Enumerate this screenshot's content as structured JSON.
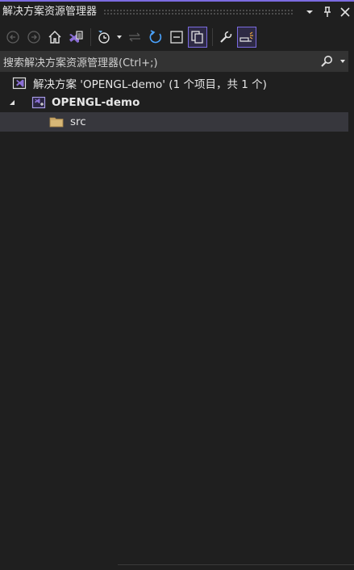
{
  "window": {
    "title": "解决方案资源管理器",
    "accent_color": "#7b6be0"
  },
  "titlebar_buttons": [
    {
      "name": "dropdown-icon"
    },
    {
      "name": "pin-icon"
    },
    {
      "name": "close-icon"
    }
  ],
  "toolbar": {
    "buttons": [
      {
        "name": "back-icon",
        "state": "disabled"
      },
      {
        "name": "forward-icon",
        "state": "disabled"
      },
      {
        "name": "home-icon",
        "state": "enabled"
      },
      {
        "name": "switch-views-icon",
        "state": "enabled"
      },
      {
        "name": "pending-changes-filter-icon",
        "state": "enabled"
      },
      {
        "name": "sync-with-active-document-icon",
        "state": "disabled"
      },
      {
        "name": "refresh-icon",
        "state": "enabled"
      },
      {
        "name": "collapse-all-icon",
        "state": "enabled"
      },
      {
        "name": "show-all-files-icon",
        "state": "active"
      },
      {
        "name": "properties-icon",
        "state": "enabled"
      },
      {
        "name": "preview-selected-items-icon",
        "state": "active"
      }
    ]
  },
  "search": {
    "placeholder": "搜索解决方案资源管理器(Ctrl+;)"
  },
  "tree": {
    "solution_label": "解决方案 'OPENGL-demo' (1 个项目，共 1 个)",
    "project_label": "OPENGL-demo",
    "folder_label": "src",
    "selected": "src"
  }
}
